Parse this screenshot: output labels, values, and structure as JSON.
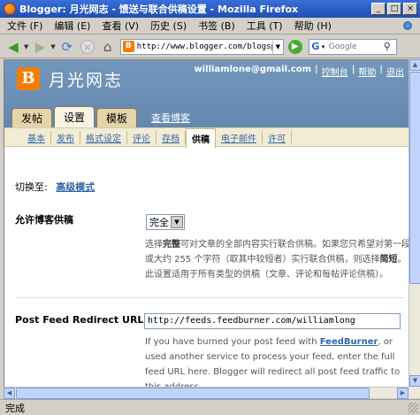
{
  "window": {
    "title": "Blogger: 月光网志 - 馈送与联合供稿设置 - Mozilla Firefox",
    "buttons": [
      "_",
      "□",
      "×"
    ]
  },
  "menu": [
    "文件 (F)",
    "编辑 (E)",
    "查看 (V)",
    "历史 (S)",
    "书签 (B)",
    "工具 (T)",
    "帮助 (H)"
  ],
  "nav": {
    "url": "http://www.blogger.com/blogsp",
    "search_placeholder": "Google"
  },
  "header": {
    "logo_letter": "B",
    "blog_name": "月光网志",
    "user_email": "williamlone@gmail.com",
    "links": [
      "控制台",
      "帮助",
      "退出"
    ]
  },
  "tabs": {
    "main": [
      "发帖",
      "设置",
      "模板"
    ],
    "active_main": "设置",
    "view_blog": "查看博客",
    "sub": [
      "基本",
      "发布",
      "格式设定",
      "评论",
      "存档",
      "供稿",
      "电子邮件",
      "许可"
    ],
    "active_sub": "供稿"
  },
  "settings": {
    "switch_label": "切换至:",
    "switch_link": "高级模式",
    "feed_label": "允许博客供稿",
    "feed_value": "完全",
    "feed_desc_1": "选择",
    "feed_desc_bold_1": "完整",
    "feed_desc_2": "可对文章的全部内容实行联合供稿。如果您只希望对第一段或大约 255 个字符（取其中较短者）实行联合供稿，则选择",
    "feed_desc_bold_2": "简短",
    "feed_desc_3": "。此设置适用于所有类型的供稿（文章、评论和每帖评论供稿）。",
    "redirect_label": "Post Feed Redirect URL",
    "redirect_value": "http://feeds.feedburner.com/williamlong",
    "redirect_desc_1": "If you have burned your post feed with ",
    "redirect_desc_link": "FeedBurner",
    "redirect_desc_2": ", or used another service to process your feed, enter the full feed URL here. Blogger will redirect all post feed traffic to this address."
  },
  "status": {
    "text": "完成"
  },
  "colors": {
    "header_bg": "#6a8fb6",
    "tab_bg": "#e3d5a9",
    "link": "#3366aa",
    "blogger_orange": "#f57d00"
  }
}
